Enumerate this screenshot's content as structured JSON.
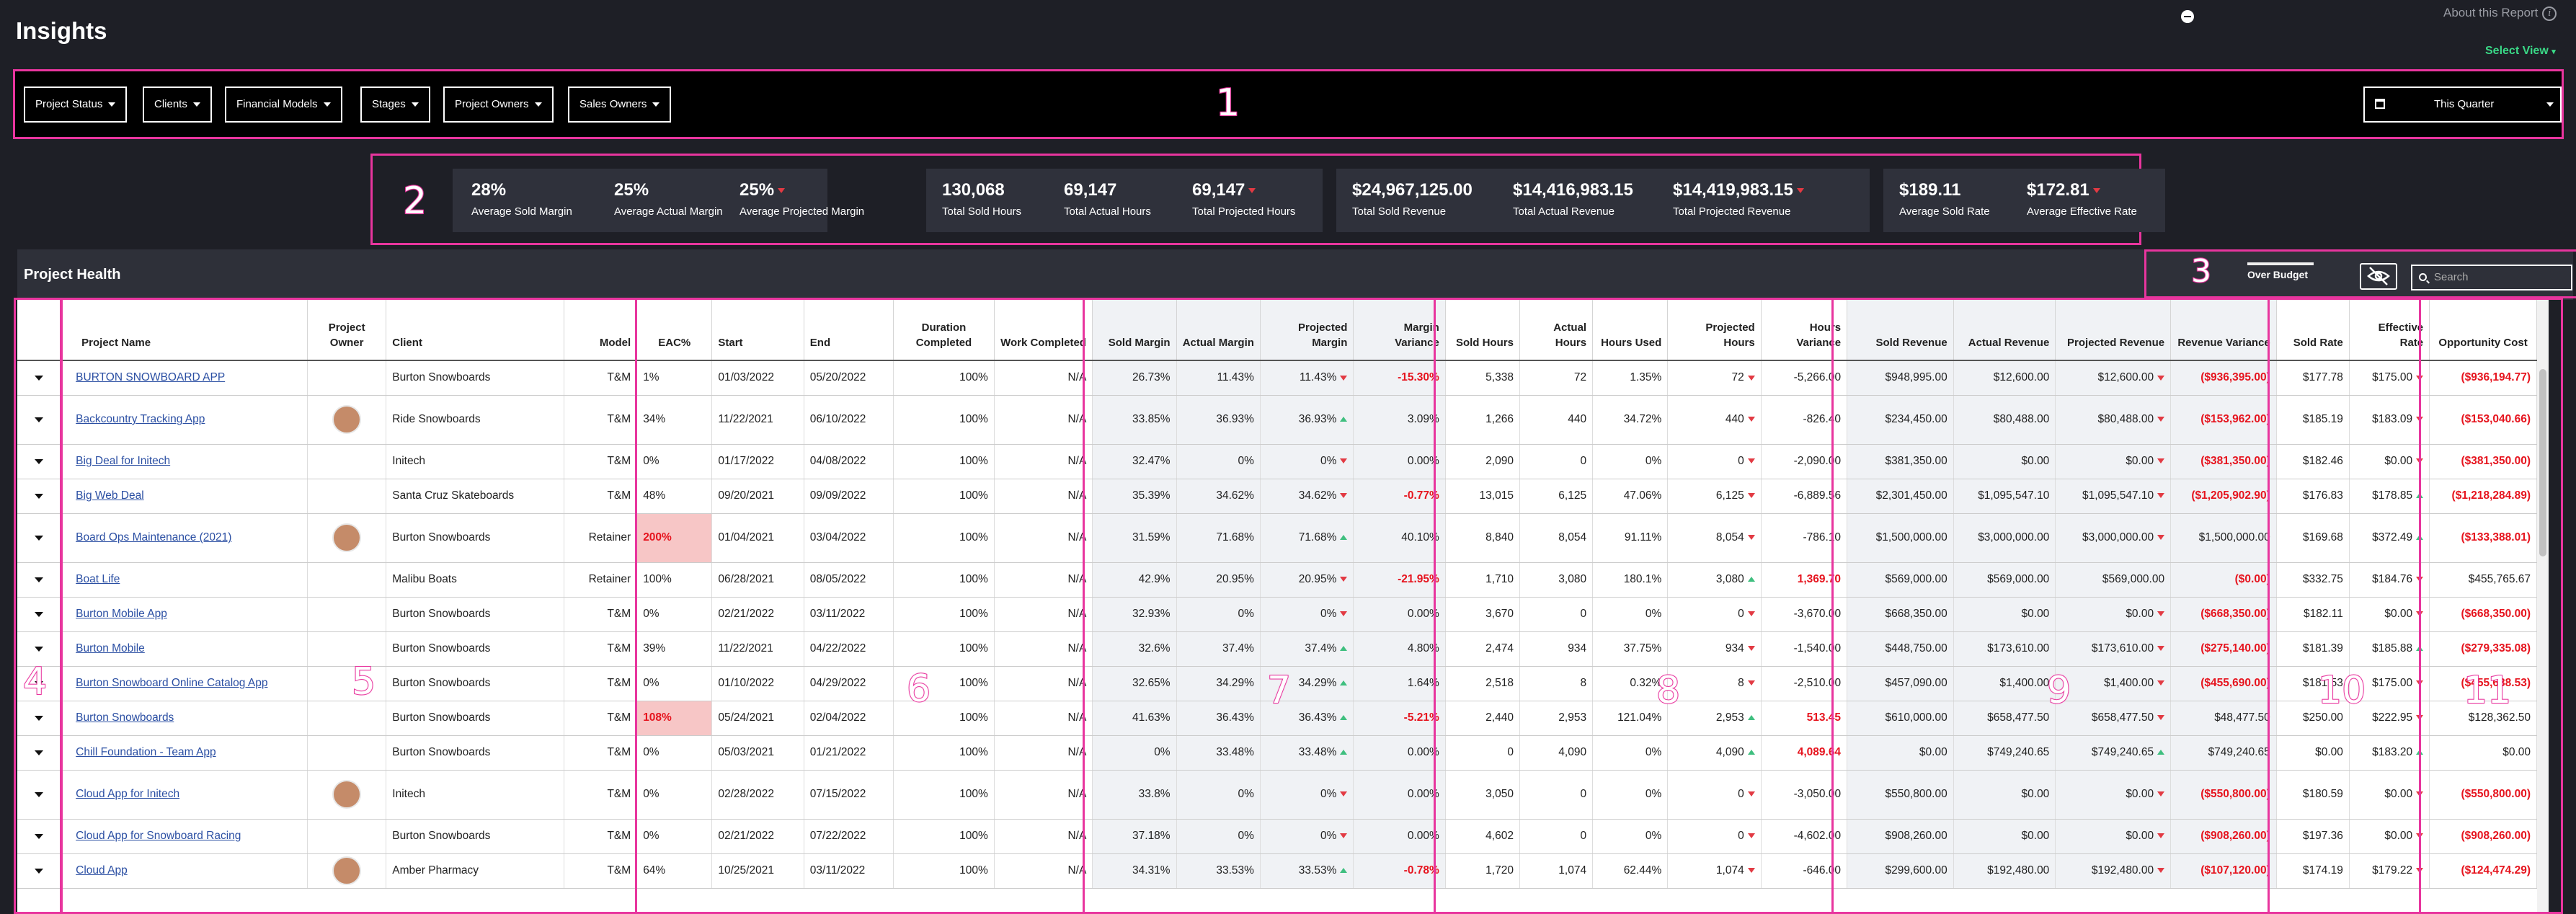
{
  "app": {
    "title": "Insights",
    "about": "About this Report",
    "select_view": "Select View"
  },
  "filters": {
    "buttons": [
      "Project Status",
      "Clients",
      "Financial Models",
      "Stages",
      "Project Owners",
      "Sales Owners"
    ],
    "period": "This Quarter"
  },
  "annotations": [
    "1",
    "2",
    "3",
    "4",
    "5",
    "6",
    "7",
    "8",
    "9",
    "10",
    "11"
  ],
  "kpis": [
    {
      "value": "28%",
      "label": "Average Sold Margin",
      "trend": ""
    },
    {
      "value": "25%",
      "label": "Average Actual Margin",
      "trend": ""
    },
    {
      "value": "25%",
      "label": "Average Projected Margin",
      "trend": "down"
    },
    {
      "value": "130,068",
      "label": "Total Sold Hours",
      "trend": ""
    },
    {
      "value": "69,147",
      "label": "Total Actual Hours",
      "trend": ""
    },
    {
      "value": "69,147",
      "label": "Total Projected Hours",
      "trend": "down"
    },
    {
      "value": "$24,967,125.00",
      "label": "Total Sold Revenue",
      "trend": ""
    },
    {
      "value": "$14,416,983.15",
      "label": "Total Actual Revenue",
      "trend": ""
    },
    {
      "value": "$14,419,983.15",
      "label": "Total Projected Revenue",
      "trend": "down"
    },
    {
      "value": "$189.11",
      "label": "Average Sold Rate",
      "trend": ""
    },
    {
      "value": "$172.81",
      "label": "Average Effective Rate",
      "trend": "down"
    }
  ],
  "project_health": {
    "title": "Project Health",
    "over_budget": "Over Budget",
    "search_placeholder": "Search"
  },
  "columns": [
    "Project Name",
    "Project Owner",
    "Client",
    "Model",
    "EAC%",
    "Start",
    "End",
    "Duration Completed",
    "Work Completed",
    "Sold Margin",
    "Actual Margin",
    "Projected Margin",
    "Margin Variance",
    "Sold Hours",
    "Actual Hours",
    "Hours Used",
    "Projected Hours",
    "Hours Variance",
    "Sold Revenue",
    "Actual Revenue",
    "Projected Revenue",
    "Revenue Variance",
    "Sold Rate",
    "Effective Rate",
    "Opportunity Cost"
  ],
  "rows": [
    {
      "name": "BURTON SNOWBOARD APP",
      "avatar": false,
      "client": "Burton Snowboards",
      "model": "T&M",
      "eac": "1%",
      "eac_high": false,
      "start": "01/03/2022",
      "end": "05/20/2022",
      "dur": "100%",
      "work": "N/A",
      "smargin": "26.73%",
      "amargin": "11.43%",
      "pmargin": "11.43%",
      "pmargin_t": "down",
      "mvar": "-15.30%",
      "mvar_red": true,
      "shours": "5,338",
      "ahours": "72",
      "hused": "1.35%",
      "phours": "72",
      "phours_t": "down",
      "hvar": "-5,266.00",
      "hvar_red": false,
      "srev": "$948,995.00",
      "arev": "$12,600.00",
      "prev": "$12,600.00",
      "prev_t": "down",
      "rvar": "($936,395.00)",
      "rvar_red": true,
      "srate": "$177.78",
      "erate": "$175.00",
      "erate_t": "down",
      "opp": "($936,194.77)",
      "opp_red": true
    },
    {
      "name": "Backcountry Tracking App",
      "avatar": true,
      "client": "Ride Snowboards",
      "model": "T&M",
      "eac": "34%",
      "eac_high": false,
      "start": "11/22/2021",
      "end": "06/10/2022",
      "dur": "100%",
      "work": "N/A",
      "smargin": "33.85%",
      "amargin": "36.93%",
      "pmargin": "36.93%",
      "pmargin_t": "up",
      "mvar": "3.09%",
      "mvar_red": false,
      "shours": "1,266",
      "ahours": "440",
      "hused": "34.72%",
      "phours": "440",
      "phours_t": "down",
      "hvar": "-826.40",
      "hvar_red": false,
      "srev": "$234,450.00",
      "arev": "$80,488.00",
      "prev": "$80,488.00",
      "prev_t": "down",
      "rvar": "($153,962.00)",
      "rvar_red": true,
      "srate": "$185.19",
      "erate": "$183.09",
      "erate_t": "down",
      "opp": "($153,040.66)",
      "opp_red": true
    },
    {
      "name": "Big Deal for Initech",
      "avatar": false,
      "client": "Initech",
      "model": "T&M",
      "eac": "0%",
      "eac_high": false,
      "start": "01/17/2022",
      "end": "04/08/2022",
      "dur": "100%",
      "work": "N/A",
      "smargin": "32.47%",
      "amargin": "0%",
      "pmargin": "0%",
      "pmargin_t": "down",
      "mvar": "0.00%",
      "mvar_red": false,
      "shours": "2,090",
      "ahours": "0",
      "hused": "0%",
      "phours": "0",
      "phours_t": "down",
      "hvar": "-2,090.00",
      "hvar_red": false,
      "srev": "$381,350.00",
      "arev": "$0.00",
      "prev": "$0.00",
      "prev_t": "down",
      "rvar": "($381,350.00)",
      "rvar_red": true,
      "srate": "$182.46",
      "erate": "$0.00",
      "erate_t": "down",
      "opp": "($381,350.00)",
      "opp_red": true
    },
    {
      "name": "Big Web Deal",
      "avatar": false,
      "client": "Santa Cruz Skateboards",
      "model": "T&M",
      "eac": "48%",
      "eac_high": false,
      "start": "09/20/2021",
      "end": "09/09/2022",
      "dur": "100%",
      "work": "N/A",
      "smargin": "35.39%",
      "amargin": "34.62%",
      "pmargin": "34.62%",
      "pmargin_t": "down",
      "mvar": "-0.77%",
      "mvar_red": true,
      "shours": "13,015",
      "ahours": "6,125",
      "hused": "47.06%",
      "phours": "6,125",
      "phours_t": "down",
      "hvar": "-6,889.56",
      "hvar_red": false,
      "srev": "$2,301,450.00",
      "arev": "$1,095,547.10",
      "prev": "$1,095,547.10",
      "prev_t": "down",
      "rvar": "($1,205,902.90)",
      "rvar_red": true,
      "srate": "$176.83",
      "erate": "$178.85",
      "erate_t": "up",
      "opp": "($1,218,284.89)",
      "opp_red": true
    },
    {
      "name": "Board Ops Maintenance (2021)",
      "avatar": true,
      "client": "Burton Snowboards",
      "model": "Retainer",
      "eac": "200%",
      "eac_high": true,
      "start": "01/04/2021",
      "end": "03/04/2022",
      "dur": "100%",
      "work": "N/A",
      "smargin": "31.59%",
      "amargin": "71.68%",
      "pmargin": "71.68%",
      "pmargin_t": "up",
      "mvar": "40.10%",
      "mvar_red": false,
      "shours": "8,840",
      "ahours": "8,054",
      "hused": "91.11%",
      "phours": "8,054",
      "phours_t": "down",
      "hvar": "-786.10",
      "hvar_red": false,
      "srev": "$1,500,000.00",
      "arev": "$3,000,000.00",
      "prev": "$3,000,000.00",
      "prev_t": "down",
      "rvar": "$1,500,000.00",
      "rvar_red": false,
      "srate": "$169.68",
      "erate": "$372.49",
      "erate_t": "up",
      "opp": "($133,388.01)",
      "opp_red": true
    },
    {
      "name": "Boat Life",
      "avatar": false,
      "client": "Malibu Boats",
      "model": "Retainer",
      "eac": "100%",
      "eac_high": false,
      "start": "06/28/2021",
      "end": "08/05/2022",
      "dur": "100%",
      "work": "N/A",
      "smargin": "42.9%",
      "amargin": "20.95%",
      "pmargin": "20.95%",
      "pmargin_t": "down",
      "mvar": "-21.95%",
      "mvar_red": true,
      "shours": "1,710",
      "ahours": "3,080",
      "hused": "180.1%",
      "phours": "3,080",
      "phours_t": "up",
      "hvar": "1,369.70",
      "hvar_red": true,
      "srev": "$569,000.00",
      "arev": "$569,000.00",
      "prev": "$569,000.00",
      "prev_t": "",
      "rvar": "($0.00)",
      "rvar_red": true,
      "srate": "$332.75",
      "erate": "$184.76",
      "erate_t": "down",
      "opp": "$455,765.67",
      "opp_red": false
    },
    {
      "name": "Burton Mobile App",
      "avatar": false,
      "client": "Burton Snowboards",
      "model": "T&M",
      "eac": "0%",
      "eac_high": false,
      "start": "02/21/2022",
      "end": "03/11/2022",
      "dur": "100%",
      "work": "N/A",
      "smargin": "32.93%",
      "amargin": "0%",
      "pmargin": "0%",
      "pmargin_t": "down",
      "mvar": "0.00%",
      "mvar_red": false,
      "shours": "3,670",
      "ahours": "0",
      "hused": "0%",
      "phours": "0",
      "phours_t": "down",
      "hvar": "-3,670.00",
      "hvar_red": false,
      "srev": "$668,350.00",
      "arev": "$0.00",
      "prev": "$0.00",
      "prev_t": "down",
      "rvar": "($668,350.00)",
      "rvar_red": true,
      "srate": "$182.11",
      "erate": "$0.00",
      "erate_t": "down",
      "opp": "($668,350.00)",
      "opp_red": true
    },
    {
      "name": "Burton Mobile",
      "avatar": false,
      "client": "Burton Snowboards",
      "model": "T&M",
      "eac": "39%",
      "eac_high": false,
      "start": "11/22/2021",
      "end": "04/22/2022",
      "dur": "100%",
      "work": "N/A",
      "smargin": "32.6%",
      "amargin": "37.4%",
      "pmargin": "37.4%",
      "pmargin_t": "up",
      "mvar": "4.80%",
      "mvar_red": false,
      "shours": "2,474",
      "ahours": "934",
      "hused": "37.75%",
      "phours": "934",
      "phours_t": "down",
      "hvar": "-1,540.00",
      "hvar_red": false,
      "srev": "$448,750.00",
      "arev": "$173,610.00",
      "prev": "$173,610.00",
      "prev_t": "down",
      "rvar": "($275,140.00)",
      "rvar_red": true,
      "srate": "$181.39",
      "erate": "$185.88",
      "erate_t": "up",
      "opp": "($279,335.08)",
      "opp_red": true
    },
    {
      "name": "Burton Snowboard Online Catalog App",
      "avatar": false,
      "client": "Burton Snowboards",
      "model": "T&M",
      "eac": "0%",
      "eac_high": false,
      "start": "01/10/2022",
      "end": "04/29/2022",
      "dur": "100%",
      "work": "N/A",
      "smargin": "32.65%",
      "amargin": "34.29%",
      "pmargin": "34.29%",
      "pmargin_t": "up",
      "mvar": "1.64%",
      "mvar_red": false,
      "shours": "2,518",
      "ahours": "8",
      "hused": "0.32%",
      "phours": "8",
      "phours_t": "down",
      "hvar": "-2,510.00",
      "hvar_red": false,
      "srev": "$457,090.00",
      "arev": "$1,400.00",
      "prev": "$1,400.00",
      "prev_t": "down",
      "rvar": "($455,690.00)",
      "rvar_red": true,
      "srate": "$181.53",
      "erate": "$175.00",
      "erate_t": "down",
      "opp": "($455,688.53)",
      "opp_red": true
    },
    {
      "name": "Burton Snowboards",
      "avatar": false,
      "client": "Burton Snowboards",
      "model": "T&M",
      "eac": "108%",
      "eac_high": true,
      "start": "05/24/2021",
      "end": "02/04/2022",
      "dur": "100%",
      "work": "N/A",
      "smargin": "41.63%",
      "amargin": "36.43%",
      "pmargin": "36.43%",
      "pmargin_t": "up",
      "mvar": "-5.21%",
      "mvar_red": true,
      "shours": "2,440",
      "ahours": "2,953",
      "hused": "121.04%",
      "phours": "2,953",
      "phours_t": "up",
      "hvar": "513.45",
      "hvar_red": true,
      "srev": "$610,000.00",
      "arev": "$658,477.50",
      "prev": "$658,477.50",
      "prev_t": "down",
      "rvar": "$48,477.50",
      "rvar_red": false,
      "srate": "$250.00",
      "erate": "$222.95",
      "erate_t": "down",
      "opp": "$128,362.50",
      "opp_red": false
    },
    {
      "name": "Chill Foundation - Team App",
      "avatar": false,
      "client": "Burton Snowboards",
      "model": "T&M",
      "eac": "0%",
      "eac_high": false,
      "start": "05/03/2021",
      "end": "01/21/2022",
      "dur": "100%",
      "work": "N/A",
      "smargin": "0%",
      "amargin": "33.48%",
      "pmargin": "33.48%",
      "pmargin_t": "up",
      "mvar": "0.00%",
      "mvar_red": false,
      "shours": "0",
      "ahours": "4,090",
      "hused": "0%",
      "phours": "4,090",
      "phours_t": "up",
      "hvar": "4,089.64",
      "hvar_red": true,
      "srev": "$0.00",
      "arev": "$749,240.65",
      "prev": "$749,240.65",
      "prev_t": "up",
      "rvar": "$749,240.65",
      "rvar_red": false,
      "srate": "$0.00",
      "erate": "$183.20",
      "erate_t": "up",
      "opp": "$0.00",
      "opp_red": false
    },
    {
      "name": "Cloud App for Initech",
      "avatar": true,
      "client": "Initech",
      "model": "T&M",
      "eac": "0%",
      "eac_high": false,
      "start": "02/28/2022",
      "end": "07/15/2022",
      "dur": "100%",
      "work": "N/A",
      "smargin": "33.8%",
      "amargin": "0%",
      "pmargin": "0%",
      "pmargin_t": "down",
      "mvar": "0.00%",
      "mvar_red": false,
      "shours": "3,050",
      "ahours": "0",
      "hused": "0%",
      "phours": "0",
      "phours_t": "down",
      "hvar": "-3,050.00",
      "hvar_red": false,
      "srev": "$550,800.00",
      "arev": "$0.00",
      "prev": "$0.00",
      "prev_t": "down",
      "rvar": "($550,800.00)",
      "rvar_red": true,
      "srate": "$180.59",
      "erate": "$0.00",
      "erate_t": "down",
      "opp": "($550,800.00)",
      "opp_red": true
    },
    {
      "name": "Cloud App for Snowboard Racing",
      "avatar": false,
      "client": "Burton Snowboards",
      "model": "T&M",
      "eac": "0%",
      "eac_high": false,
      "start": "02/21/2022",
      "end": "07/22/2022",
      "dur": "100%",
      "work": "N/A",
      "smargin": "37.18%",
      "amargin": "0%",
      "pmargin": "0%",
      "pmargin_t": "down",
      "mvar": "0.00%",
      "mvar_red": false,
      "shours": "4,602",
      "ahours": "0",
      "hused": "0%",
      "phours": "0",
      "phours_t": "down",
      "hvar": "-4,602.00",
      "hvar_red": false,
      "srev": "$908,260.00",
      "arev": "$0.00",
      "prev": "$0.00",
      "prev_t": "down",
      "rvar": "($908,260.00)",
      "rvar_red": true,
      "srate": "$197.36",
      "erate": "$0.00",
      "erate_t": "down",
      "opp": "($908,260.00)",
      "opp_red": true
    },
    {
      "name": "Cloud App",
      "avatar": true,
      "client": "Amber Pharmacy",
      "model": "T&M",
      "eac": "64%",
      "eac_high": false,
      "start": "10/25/2021",
      "end": "03/11/2022",
      "dur": "100%",
      "work": "N/A",
      "smargin": "34.31%",
      "amargin": "33.53%",
      "pmargin": "33.53%",
      "pmargin_t": "up",
      "mvar": "-0.78%",
      "mvar_red": true,
      "shours": "1,720",
      "ahours": "1,074",
      "hused": "62.44%",
      "phours": "1,074",
      "phours_t": "down",
      "hvar": "-646.00",
      "hvar_red": false,
      "srev": "$299,600.00",
      "arev": "$192,480.00",
      "prev": "$192,480.00",
      "prev_t": "down",
      "rvar": "($107,120.00)",
      "rvar_red": true,
      "srate": "$174.19",
      "erate": "$179.22",
      "erate_t": "down",
      "opp": "($124,474.29)",
      "opp_red": true
    }
  ]
}
